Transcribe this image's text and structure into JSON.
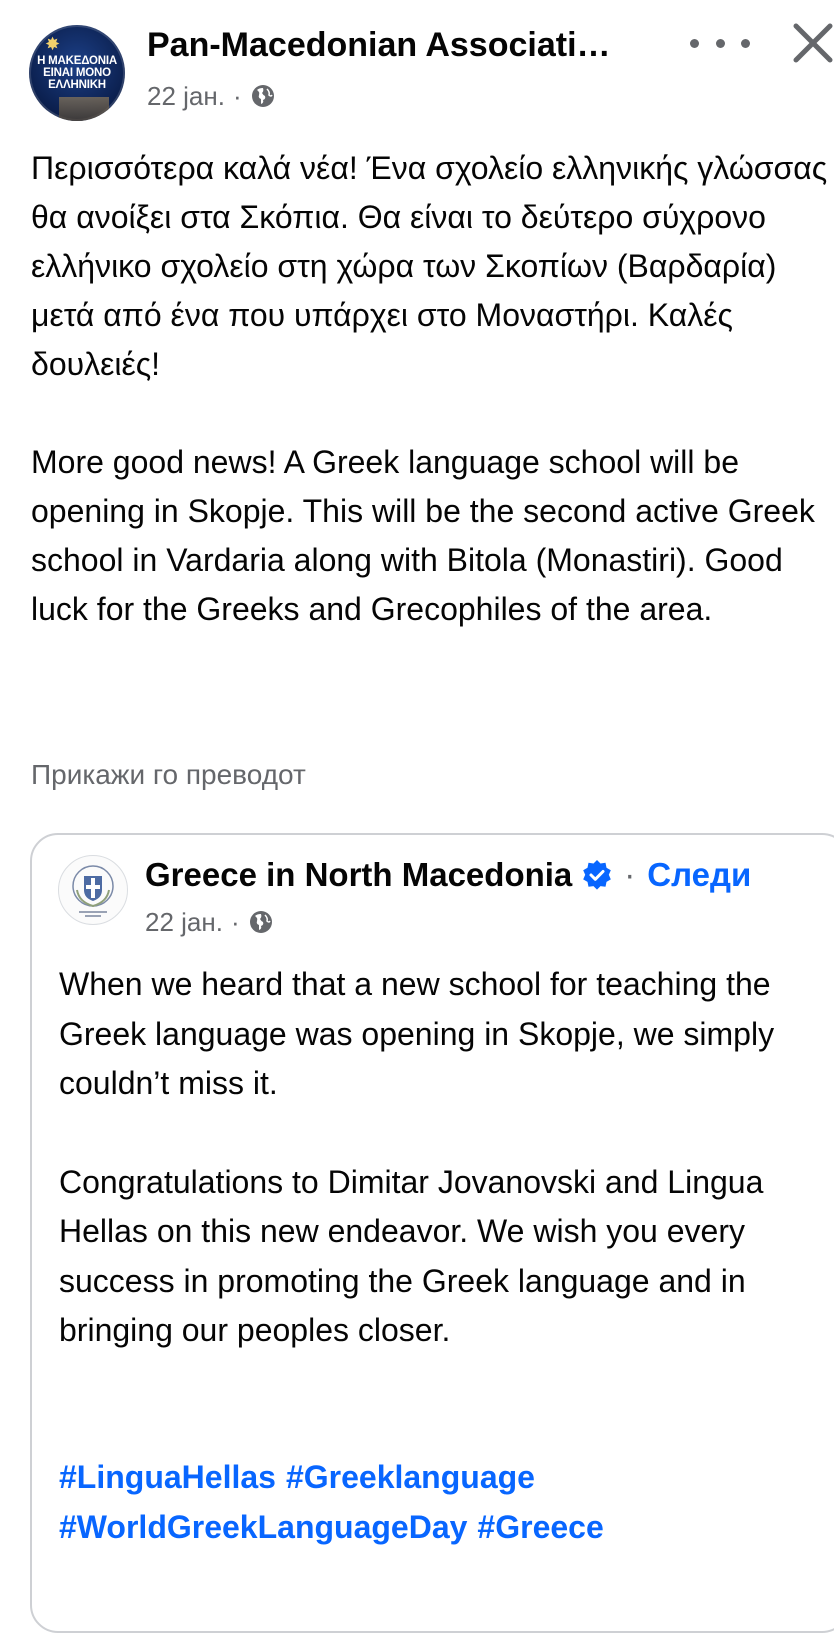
{
  "post": {
    "avatar_text": "Η ΜΑΚΕΔΟΝΙΑ ΕΙΝΑΙ ΜΟΝΟ ΕΛΛΗΝΙΚΗ",
    "author": "Pan-Macedonian Associati…",
    "date": "22 јан.",
    "separator": "·",
    "audience_icon": "globe-icon",
    "body_greek": "Περισσότερα καλά νέα! Ένα σχολείο ελληνικής γλώσσας θα ανοίξει στα Σκόπια. Θα είναι το δεύτερο σύχρονο ελλήνικο σχολείο στη χώρα των Σκοπίων (Βαρδαρία) μετά από ένα που υπάρχει στο Μοναστήρι. Καλές δουλειές!",
    "body_english": "More good news! A Greek language school will be opening in Skopje. This will be the second active Greek school in Vardaria along with Bitola (Monastiri). Good luck for the Greeks and Grecophiles of the area.",
    "translate_label": "Прикажи го преводот"
  },
  "shared": {
    "author": "Greece in North Macedonia",
    "separator": "·",
    "follow_label": "Следи",
    "date": "22 јан.",
    "paragraph1": "When we heard that a new school for teaching the Greek language was opening in Skopje, we simply couldn’t miss it.",
    "paragraph2": "Congratulations to Dimitar Jovanovski and Lingua Hellas on this new endeavor. We wish you every success in promoting the Greek language and in bringing our peoples closer.",
    "hashtags": [
      "#LinguaHellas",
      "#Greeklanguage",
      "#WorldGreekLanguageDay",
      "#Greece"
    ]
  },
  "colors": {
    "text": "#050505",
    "secondary": "#65676b",
    "link": "#0866ff",
    "border": "#ced0d4"
  }
}
